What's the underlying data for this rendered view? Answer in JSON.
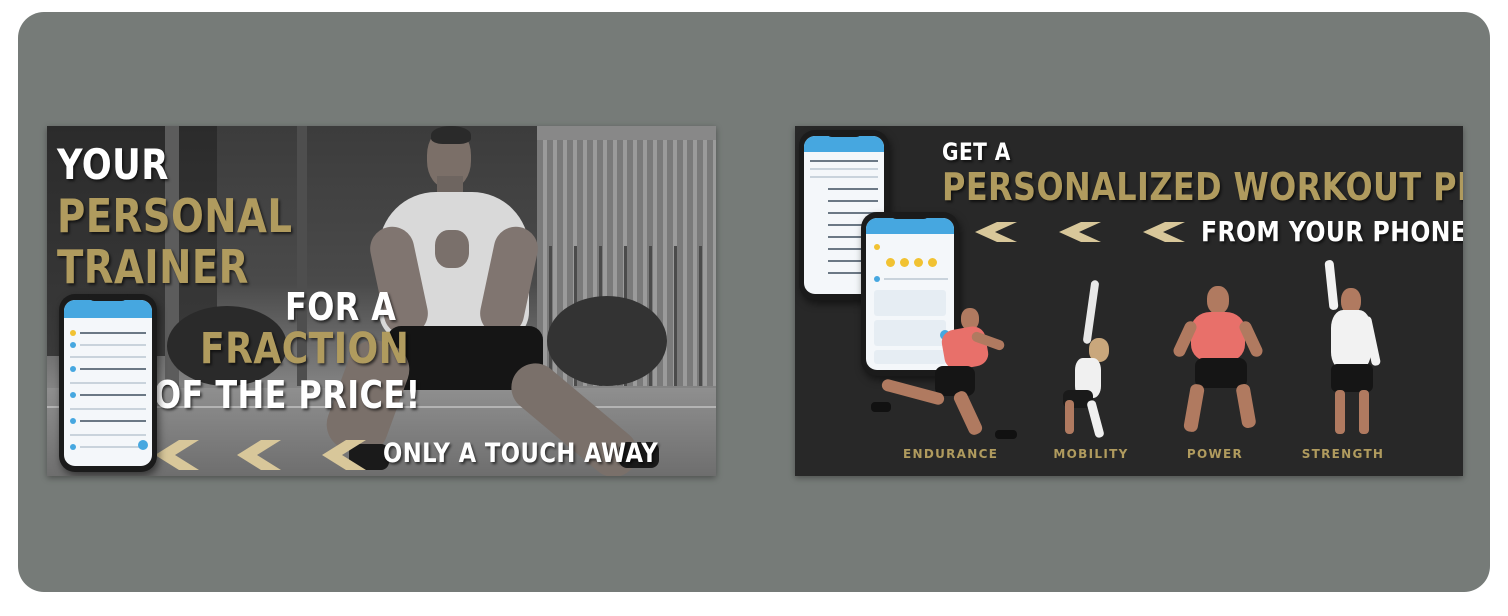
{
  "banner1": {
    "line1": "YOUR",
    "line2": "PERSONAL",
    "line3": "TRAINER",
    "line4": "FOR A",
    "line5": "FRACTION",
    "line6": "OF THE PRICE!",
    "tagline": "ONLY A TOUCH AWAY"
  },
  "banner2": {
    "kicker": "GET A",
    "headline": "PERSONALIZED WORKOUT PLAN",
    "subline": "FROM YOUR PHONE",
    "categories": [
      "ENDURANCE",
      "MOBILITY",
      "POWER",
      "STRENGTH"
    ]
  },
  "colors": {
    "frame": "#767b78",
    "gold": "#b09b5e",
    "white": "#ffffff",
    "banner_dark": "#282828",
    "app_blue": "#46a7e0"
  },
  "icons": [
    "chevron-left-icon",
    "phone-mockup"
  ]
}
